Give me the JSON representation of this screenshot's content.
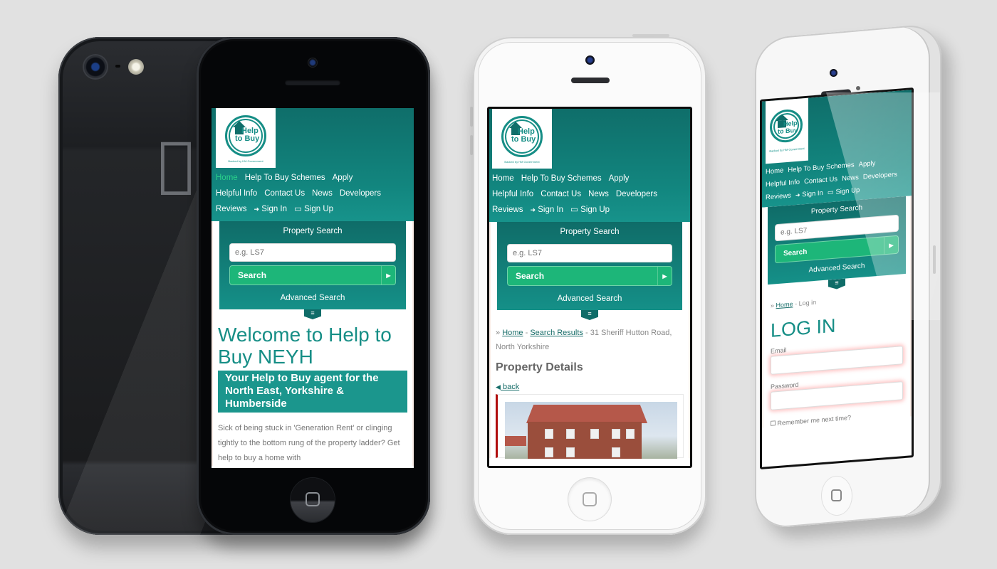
{
  "site": {
    "logo": {
      "line1": "Help",
      "line2": "to Buy",
      "tagline": "Backed by HM Government"
    },
    "nav": [
      {
        "label": "Home",
        "icon": ""
      },
      {
        "label": "Help To Buy Schemes",
        "icon": ""
      },
      {
        "label": "Apply",
        "icon": ""
      },
      {
        "label": "Helpful Info",
        "icon": ""
      },
      {
        "label": "Contact Us",
        "icon": ""
      },
      {
        "label": "News",
        "icon": ""
      },
      {
        "label": "Developers",
        "icon": ""
      },
      {
        "label": "Reviews",
        "icon": ""
      },
      {
        "label": "Sign In",
        "icon": "sign-in-icon"
      },
      {
        "label": "Sign Up",
        "icon": "sign-up-icon"
      }
    ],
    "search": {
      "title": "Property Search",
      "placeholder": "e.g. LS7",
      "button_label": "Search",
      "advanced_label": "Advanced Search"
    },
    "icons": {
      "sign_in": "➜",
      "sign_up": "▭",
      "arrow_right": "▶",
      "menu": "≡",
      "back": "◀"
    },
    "colors": {
      "brand_teal": "#168e86",
      "header_dark": "#0f6e6a",
      "search_green": "#1db679",
      "active_nav": "#2bd28a",
      "accent_red": "#b10d0d"
    }
  },
  "phone_home": {
    "active_nav": "Home",
    "welcome_title": "Welcome to Help to Buy NEYH",
    "agent_banner": "Your Help to Buy agent for the North East, Yorkshire & Humberside",
    "body_text": "Sick of being stuck in 'Generation Rent' or clinging tightly to the bottom rung of the property ladder? Get help to buy a home with"
  },
  "phone_property": {
    "breadcrumb_prefix": "»",
    "breadcrumb_home": "Home",
    "breadcrumb_sep": "-",
    "breadcrumb_results": "Search Results",
    "breadcrumb_current": "31 Sheriff Hutton Road, North Yorkshire",
    "page_title": "Property Details",
    "back_label": "back"
  },
  "phone_login": {
    "breadcrumb_prefix": "»",
    "breadcrumb_home": "Home",
    "breadcrumb_current": "Log in",
    "page_title": "LOG IN",
    "email_label": "Email",
    "email_value": "",
    "password_label": "Password",
    "password_value": "",
    "remember_label": "Remember me next time?"
  }
}
